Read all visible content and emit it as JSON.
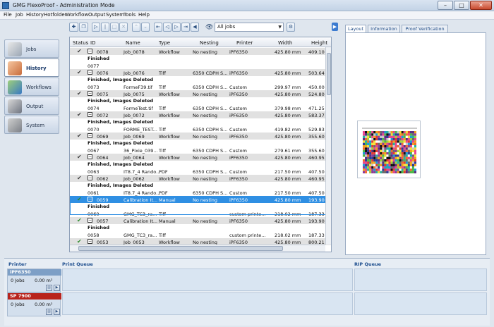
{
  "window": {
    "title": "GMG FlexoProof - Administration Mode",
    "minimize_glyph": "–",
    "maximize_glyph": "□",
    "close_glyph": "✕"
  },
  "menu": [
    "File",
    "Job",
    "History",
    "Hotfolder",
    "Workflow",
    "Output",
    "System",
    "Tools",
    "Help"
  ],
  "toolbar": {
    "filter_value": "All jobs",
    "icons": [
      "new-job-icon",
      "copy-icon",
      "play-icon",
      "pause-icon",
      "stop-icon",
      "delete-icon",
      "up-icon",
      "down-icon",
      "first-icon",
      "previous-icon",
      "next-icon",
      "last-icon",
      "back-icon",
      "forward-icon",
      "eye-icon",
      "settings-icon"
    ]
  },
  "nav": {
    "items": [
      {
        "label": "Jobs",
        "icon": "jobs-icon"
      },
      {
        "label": "History",
        "icon": "history-icon"
      },
      {
        "label": "Workflows",
        "icon": "workflows-icon"
      },
      {
        "label": "Output",
        "icon": "output-icon"
      },
      {
        "label": "System",
        "icon": "system-icon"
      }
    ],
    "active": "History"
  },
  "table": {
    "columns": [
      "Status",
      "ID",
      "Name",
      "Type",
      "Nesting",
      "Printer",
      "Width",
      "Height"
    ],
    "rows": [
      {
        "kind": "group",
        "status": "✔",
        "status_ok": false,
        "expander": "−",
        "id": "0078",
        "name": "Job_0078",
        "type": "Workflow",
        "nesting": "No nesting",
        "printer": "iPF6350",
        "width": "425.80 mm",
        "height": "409.10 m"
      },
      {
        "kind": "status",
        "text": "Finished"
      },
      {
        "kind": "item",
        "id": "0077",
        "name": "",
        "type": "",
        "nesting": "",
        "printer": "",
        "width": "",
        "height": ""
      },
      {
        "kind": "group",
        "status": "✔",
        "status_ok": false,
        "expander": "−",
        "id": "0076",
        "name": "Job_0076",
        "type": "Tiff",
        "nesting": "6350 CDPH S...",
        "printer": "iPF6350",
        "width": "425.80 mm",
        "height": "503.64 m"
      },
      {
        "kind": "status",
        "text": "Finished, Images Deleted"
      },
      {
        "kind": "item",
        "id": "0073",
        "name": "FormeF39.tif",
        "type": "Tiff",
        "nesting": "6350 CDPH S...",
        "printer": "Custom",
        "width": "299.97 mm",
        "height": "450.00 m"
      },
      {
        "kind": "group",
        "status": "✔",
        "status_ok": false,
        "expander": "−",
        "id": "0075",
        "name": "Job_0075",
        "type": "Workflow",
        "nesting": "No nesting",
        "printer": "iPF6350",
        "width": "425.80 mm",
        "height": "524.80 m"
      },
      {
        "kind": "status",
        "text": "Finished, Images Deleted"
      },
      {
        "kind": "item",
        "id": "0074",
        "name": "FormeTest.tif",
        "type": "Tiff",
        "nesting": "6350 CDPH S...",
        "printer": "Custom",
        "width": "379.98 mm",
        "height": "471.25 m"
      },
      {
        "kind": "group",
        "status": "✔",
        "status_ok": false,
        "expander": "−",
        "id": "0072",
        "name": "Job_0072",
        "type": "Workflow",
        "nesting": "No nesting",
        "printer": "iPF6350",
        "width": "425.80 mm",
        "height": "583.37 m"
      },
      {
        "kind": "status",
        "text": "Finished, Images Deleted"
      },
      {
        "kind": "item",
        "id": "0070",
        "name": "FORME_TEST...",
        "type": "Tiff",
        "nesting": "6350 CDPH S...",
        "printer": "Custom",
        "width": "419.82 mm",
        "height": "529.83 m"
      },
      {
        "kind": "group",
        "status": "✔",
        "status_ok": false,
        "expander": "−",
        "id": "0069",
        "name": "Job_0069",
        "type": "Workflow",
        "nesting": "No nesting",
        "printer": "iPF6350",
        "width": "425.80 mm",
        "height": "355.60 m"
      },
      {
        "kind": "status",
        "text": "Finished, Images Deleted"
      },
      {
        "kind": "item",
        "id": "0067",
        "name": "36_Pixie_039...",
        "type": "Tiff",
        "nesting": "6350 CDPH S...",
        "printer": "Custom",
        "width": "279.61 mm",
        "height": "355.60 m"
      },
      {
        "kind": "group",
        "status": "✔",
        "status_ok": false,
        "expander": "−",
        "id": "0064",
        "name": "Job_0064",
        "type": "Workflow",
        "nesting": "No nesting",
        "printer": "iPF6350",
        "width": "425.80 mm",
        "height": "460.95 m"
      },
      {
        "kind": "status",
        "text": "Finished, Images Deleted"
      },
      {
        "kind": "item",
        "id": "0063",
        "name": "IT8.7_4 Rando...",
        "type": "PDF",
        "nesting": "6350 CDPH S...",
        "printer": "Custom",
        "width": "217.50 mm",
        "height": "407.50 m"
      },
      {
        "kind": "group",
        "status": "✔",
        "status_ok": false,
        "expander": "−",
        "id": "0062",
        "name": "Job_0062",
        "type": "Workflow",
        "nesting": "No nesting",
        "printer": "iPF6350",
        "width": "425.80 mm",
        "height": "460.95 m"
      },
      {
        "kind": "status",
        "text": "Finished, Images Deleted"
      },
      {
        "kind": "item",
        "id": "0061",
        "name": "IT8.7_4 Rando...",
        "type": "PDF",
        "nesting": "6350 CDPH S...",
        "printer": "Custom",
        "width": "217.50 mm",
        "height": "407.50 m"
      },
      {
        "kind": "group",
        "selected": true,
        "status": "✔",
        "status_ok": true,
        "expander": "−",
        "id": "0059",
        "name": "Calibration It...",
        "type": "Manual",
        "nesting": "No nesting",
        "printer": "iPF6350",
        "width": "425.80 mm",
        "height": "193.90 m"
      },
      {
        "kind": "status",
        "selected": true,
        "text": "Finished"
      },
      {
        "kind": "item",
        "selected": true,
        "id": "0060",
        "name": "GMG_TC3_ra...",
        "type": "Tiff",
        "nesting": "",
        "printer": "custom printe...",
        "width": "218.02 mm",
        "height": "187.33 m"
      },
      {
        "kind": "group",
        "status": "✔",
        "status_ok": true,
        "expander": "−",
        "id": "0057",
        "name": "Calibration It...",
        "type": "Manual",
        "nesting": "No nesting",
        "printer": "iPF6350",
        "width": "425.80 mm",
        "height": "193.90 m"
      },
      {
        "kind": "status",
        "text": "Finished"
      },
      {
        "kind": "item",
        "id": "0058",
        "name": "GMG_TC3_ra...",
        "type": "Tiff",
        "nesting": "",
        "printer": "custom printe...",
        "width": "218.02 mm",
        "height": "187.33 m"
      },
      {
        "kind": "group",
        "status": "✔",
        "status_ok": true,
        "expander": "−",
        "id": "0053",
        "name": "Job_0053",
        "type": "Workflow",
        "nesting": "No nesting",
        "printer": "iPF6350",
        "width": "425.80 mm",
        "height": "800.21 m"
      }
    ]
  },
  "right_panel": {
    "tabs": [
      "Layout",
      "Information",
      "Proof Verification"
    ],
    "active_tab": "Layout"
  },
  "bottom": {
    "printer_title": "Printer",
    "print_queue_title": "Print Queue",
    "rip_queue_title": "RIP Queue",
    "printers": [
      {
        "name": "iPF6350",
        "jobs": "0 Jobs",
        "size": "0.00 m²",
        "color": "#7d9fc6"
      },
      {
        "name": "SP 7900",
        "jobs": "0 Jobs",
        "size": "0.00 m²",
        "color": "#b8231c"
      }
    ]
  },
  "colors": {
    "selection": "#2f8fe3",
    "group_row": "#e1e1e1",
    "ok_check": "#2b8a2b"
  }
}
